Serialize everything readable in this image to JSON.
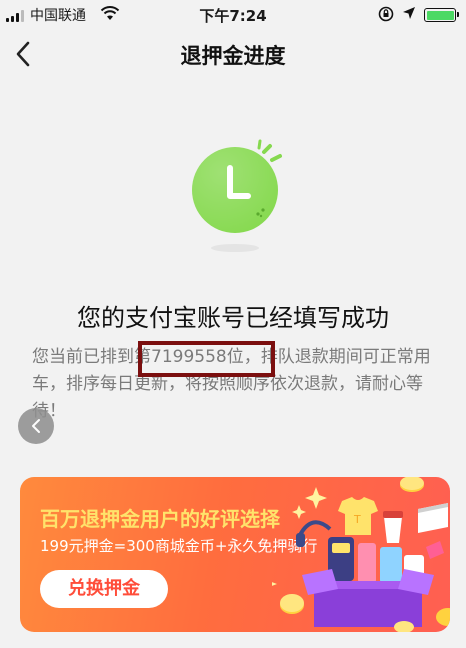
{
  "status_bar": {
    "carrier": "中国联通",
    "time": "下午7:24",
    "battery_color": "#4cd964"
  },
  "nav": {
    "back_icon": "chevron-left-icon",
    "title": "退押金进度"
  },
  "hero": {
    "icon": "clock-icon",
    "color": "#86d94f"
  },
  "main": {
    "title": "您的支付宝账号已经填写成功",
    "desc_line1": "您当前已排到第7199558位，排队退款期间可正常用",
    "desc_line2": "车，排序每日更新，将按照顺序依次退款，请耐心等",
    "desc_line3": "待！"
  },
  "banner": {
    "title": "百万退押金用户的好评选择",
    "subtitle": "199元押金=300商城金币+永久免押骑行",
    "button_label": "兑换押金",
    "title_color": "#ffe36b"
  }
}
